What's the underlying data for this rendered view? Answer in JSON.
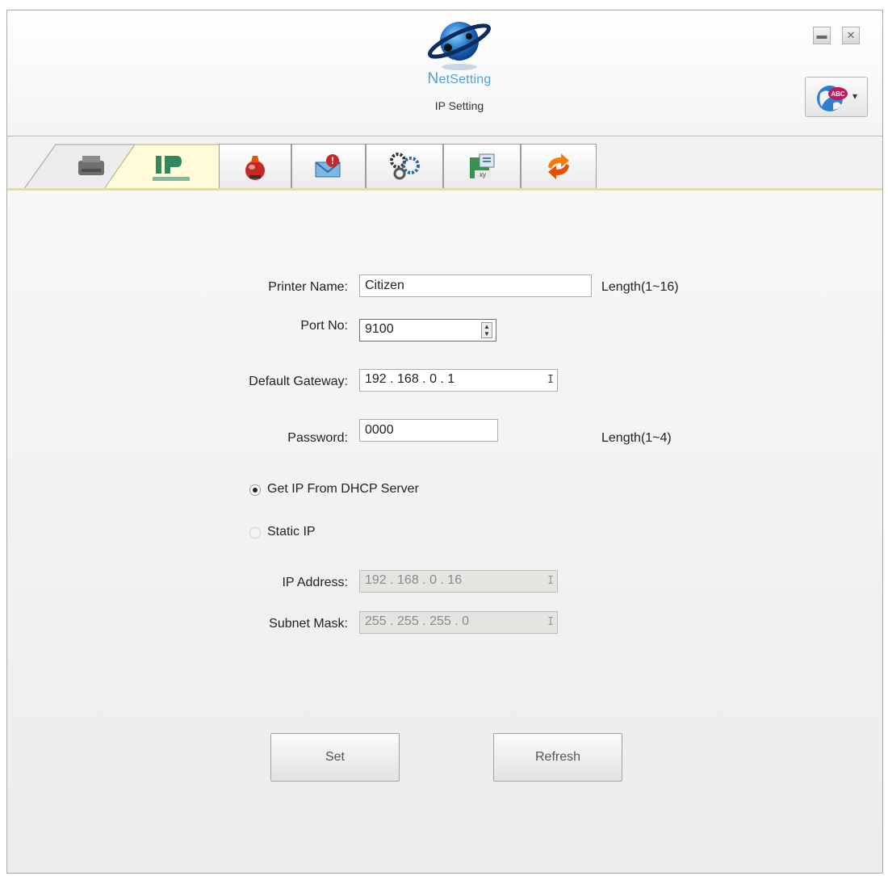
{
  "header": {
    "app_name_initial": "N",
    "app_name_rest": "etSetting",
    "subtitle": "IP Setting",
    "minimize_icon": "minimize-icon",
    "close_icon": "close-icon",
    "language_icon": "abc-globe-icon"
  },
  "tabs": [
    {
      "name": "printer",
      "icon": "printer-icon"
    },
    {
      "name": "network",
      "icon": "ip-network-icon",
      "active": true
    },
    {
      "name": "alarm",
      "icon": "alarm-bell-icon"
    },
    {
      "name": "mail",
      "icon": "mail-alert-icon"
    },
    {
      "name": "configuration",
      "icon": "gears-icon"
    },
    {
      "name": "keyboard",
      "icon": "kbd-icon"
    },
    {
      "name": "restore",
      "icon": "refresh-arrows-icon"
    }
  ],
  "form": {
    "printer_name_label": "Printer Name:",
    "printer_name_value": "Citizen",
    "printer_name_hint": "Length(1~16)",
    "port_label": "Port No:",
    "port_value": "9100",
    "gateway_label": "Default Gateway:",
    "gateway_value": "192 . 168 . 0 . 1",
    "password_label": "Password:",
    "password_value": "0000",
    "password_hint": "Length(1~4)",
    "dhcp_label": "Get IP From DHCP Server",
    "static_label": "Static IP",
    "ip_label": "IP Address:",
    "ip_value": "192 . 168 . 0 . 16",
    "mask_label": "Subnet Mask:",
    "mask_value": "255 . 255 . 255 . 0",
    "ip_mode": "dhcp"
  },
  "buttons": {
    "set": "Set",
    "refresh": "Refresh"
  },
  "colors": {
    "tab_underline": "#e9df86",
    "app_name": "#4aa3d9"
  }
}
